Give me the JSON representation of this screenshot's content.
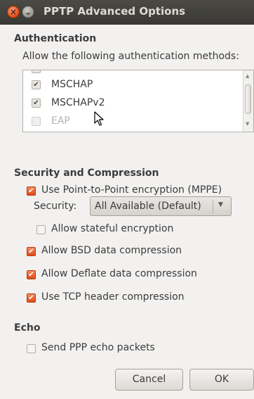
{
  "window": {
    "title": "PPTP Advanced Options",
    "close_glyph": "×",
    "minimize_glyph": "⌄"
  },
  "authentication": {
    "heading": "Authentication",
    "description": "Allow the following authentication methods:",
    "methods": [
      {
        "label": "MSCHAP",
        "checked": true,
        "enabled": true
      },
      {
        "label": "MSCHAPv2",
        "checked": true,
        "enabled": true
      },
      {
        "label": "EAP",
        "checked": false,
        "enabled": false
      }
    ]
  },
  "security": {
    "heading": "Security and Compression",
    "mppe_label": "Use Point-to-Point encryption (MPPE)",
    "mppe_checked": true,
    "security_label": "Security:",
    "security_value": "All Available (Default)",
    "stateful_label": "Allow stateful encryption",
    "stateful_checked": false,
    "bsd_label": "Allow BSD data compression",
    "bsd_checked": true,
    "deflate_label": "Allow Deflate data compression",
    "deflate_checked": true,
    "tcp_label": "Use TCP header compression",
    "tcp_checked": true
  },
  "echo": {
    "heading": "Echo",
    "send_label": "Send PPP echo packets",
    "send_checked": false
  },
  "buttons": {
    "cancel": "Cancel",
    "ok": "OK"
  },
  "glyphs": {
    "check": "✔",
    "dropdown_arrow": "▼",
    "scroll_up": "▲",
    "scroll_down": "▼"
  },
  "colors": {
    "accent_orange": "#df4a16",
    "titlebar": "#3c3b37",
    "background": "#f2f1f0"
  }
}
